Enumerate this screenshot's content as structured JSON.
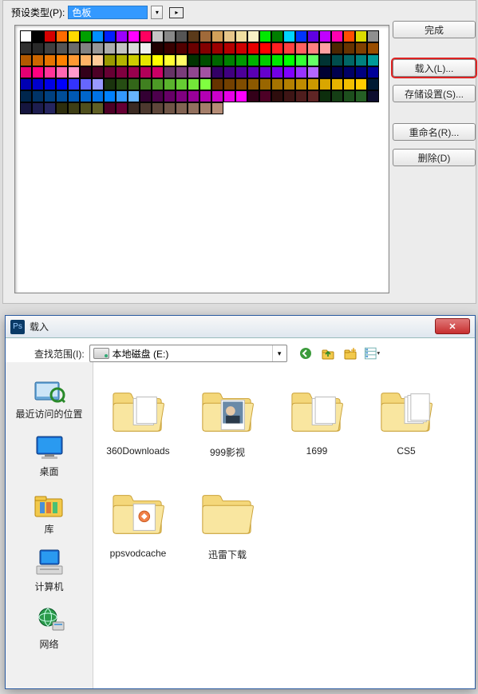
{
  "preset": {
    "type_label": "预设类型(P):",
    "type_value": "色板",
    "buttons": {
      "done": "完成",
      "load": "载入(L)...",
      "save": "存储设置(S)...",
      "rename": "重命名(R)...",
      "delete": "删除(D)"
    },
    "swatch_colors": [
      "#ffffff",
      "#000000",
      "#d60000",
      "#ff6b00",
      "#ffd800",
      "#00a000",
      "#008fff",
      "#001fff",
      "#9b00ff",
      "#ff00ff",
      "#ff0060",
      "#c5c5c5",
      "#888888",
      "#555555",
      "#5a3a1a",
      "#a06a3a",
      "#d2a05a",
      "#e7c68a",
      "#f1dfa1",
      "#f8f1c6",
      "#00e800",
      "#007f00",
      "#00d4ff",
      "#0034ff",
      "#5f00e2",
      "#c100ff",
      "#ff00b0",
      "#ff4e00",
      "#dbdb00",
      "#8f8f8f",
      "#303030",
      "#292929",
      "#3f3f3f",
      "#555555",
      "#6b6b6b",
      "#818181",
      "#979797",
      "#adadad",
      "#c3c3c3",
      "#d9d9d9",
      "#efefef",
      "#200000",
      "#380000",
      "#510000",
      "#6a0000",
      "#830000",
      "#9c0000",
      "#b50000",
      "#ce0000",
      "#e70000",
      "#ff0000",
      "#ff2020",
      "#ff4040",
      "#ff6060",
      "#ff8080",
      "#ffa0a0",
      "#4d2600",
      "#663300",
      "#804000",
      "#994d00",
      "#b35900",
      "#cc6600",
      "#e67300",
      "#ff8000",
      "#ff9933",
      "#ffb366",
      "#ffcc99",
      "#999900",
      "#b3b300",
      "#cccc00",
      "#e6e600",
      "#ffff00",
      "#ffff33",
      "#ffff66",
      "#003300",
      "#004d00",
      "#006600",
      "#008000",
      "#009900",
      "#00b300",
      "#00cc00",
      "#00e600",
      "#00ff00",
      "#33ff33",
      "#66ff66",
      "#003333",
      "#004d4d",
      "#006666",
      "#008080",
      "#009999",
      "#e60073",
      "#ff0080",
      "#ff3399",
      "#ff66b3",
      "#ff99cc",
      "#33001a",
      "#4d0026",
      "#660033",
      "#800040",
      "#99004d",
      "#b30059",
      "#cc0066",
      "#663366",
      "#7a3d7a",
      "#8f478f",
      "#a352a3",
      "#330066",
      "#400080",
      "#4d0099",
      "#5900b3",
      "#6600cc",
      "#7300e6",
      "#8000ff",
      "#9933ff",
      "#b366ff",
      "#000033",
      "#00004d",
      "#000066",
      "#000080",
      "#000099",
      "#0000b3",
      "#0000cc",
      "#0000e6",
      "#0000ff",
      "#3333ff",
      "#6666ff",
      "#9999ff",
      "#1a330d",
      "#264d13",
      "#336619",
      "#408020",
      "#4d9926",
      "#5ab32d",
      "#66cc33",
      "#73e639",
      "#80ff40",
      "#663300",
      "#734000",
      "#804d00",
      "#8c5900",
      "#996600",
      "#a67300",
      "#b38000",
      "#bf8c00",
      "#cc9900",
      "#d9a600",
      "#e6b300",
      "#f2bf00",
      "#ffcc00",
      "#001a33",
      "#00264d",
      "#003366",
      "#004080",
      "#004d99",
      "#0059b3",
      "#0066cc",
      "#0073e6",
      "#0080ff",
      "#3399ff",
      "#66b3ff",
      "#330033",
      "#4d004d",
      "#660066",
      "#800080",
      "#990099",
      "#b300b3",
      "#cc00cc",
      "#e600e6",
      "#ff00ff",
      "#330019",
      "#4d0026",
      "#2e0d0d",
      "#3e1515",
      "#4f1d1d",
      "#5f2525",
      "#0d2e0d",
      "#153e15",
      "#1d4f1d",
      "#255f25",
      "#0d0d2e",
      "#15153e",
      "#1d1d4f",
      "#25255f",
      "#2e2e0d",
      "#3e3e15",
      "#4f4f1d",
      "#5f5f25",
      "#4d0026",
      "#660033",
      "#3b2a22",
      "#4c382e",
      "#5e463a",
      "#6f5446",
      "#816252",
      "#92705e",
      "#a47e6a",
      "#b58c76"
    ]
  },
  "dialog": {
    "title": "载入",
    "lookin_label": "查找范围(I):",
    "lookin_value": "本地磁盘 (E:)",
    "places": {
      "recent": "最近访问的位置",
      "desktop": "桌面",
      "libraries": "库",
      "computer": "计算机",
      "network": "网络"
    },
    "files": [
      {
        "name": "360Downloads",
        "type": "folder-empty"
      },
      {
        "name": "999影视",
        "type": "folder-photo"
      },
      {
        "name": "1699",
        "type": "folder-empty"
      },
      {
        "name": "CS5",
        "type": "folder-docs"
      },
      {
        "name": "ppsvodcache",
        "type": "folder-file"
      },
      {
        "name": "迅雷下载",
        "type": "folder-plain"
      }
    ]
  }
}
